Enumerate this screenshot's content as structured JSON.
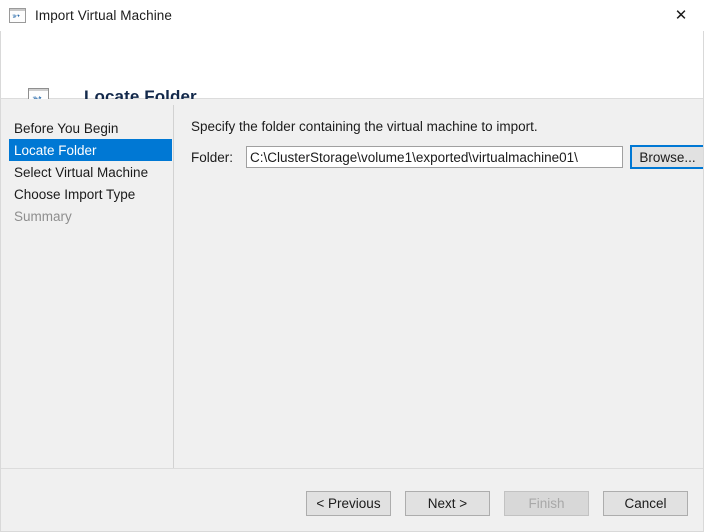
{
  "window": {
    "title": "Import Virtual Machine",
    "title_icon": "virtual-machine-icon",
    "close_label": "✕"
  },
  "header": {
    "title": "Locate Folder",
    "icon": "virtual-machine-icon"
  },
  "sidebar": {
    "items": [
      {
        "label": "Before You Begin",
        "state": "normal"
      },
      {
        "label": "Locate Folder",
        "state": "selected"
      },
      {
        "label": "Select Virtual Machine",
        "state": "normal"
      },
      {
        "label": "Choose Import Type",
        "state": "normal"
      },
      {
        "label": "Summary",
        "state": "disabled"
      }
    ]
  },
  "content": {
    "instruction": "Specify the folder containing the virtual machine to import.",
    "folder_label": "Folder:",
    "folder_value": "C:\\ClusterStorage\\volume1\\exported\\virtualmachine01\\",
    "folder_placeholder": "",
    "browse_label": "Browse..."
  },
  "footer": {
    "previous_label": "< Previous",
    "next_label": "Next >",
    "finish_label": "Finish",
    "cancel_label": "Cancel"
  },
  "colors": {
    "accent": "#0078d4",
    "title_text": "#13294b",
    "body_bg": "#f0f0f0",
    "header_bg": "#ffffff",
    "disabled_text": "#8e8e8e"
  }
}
